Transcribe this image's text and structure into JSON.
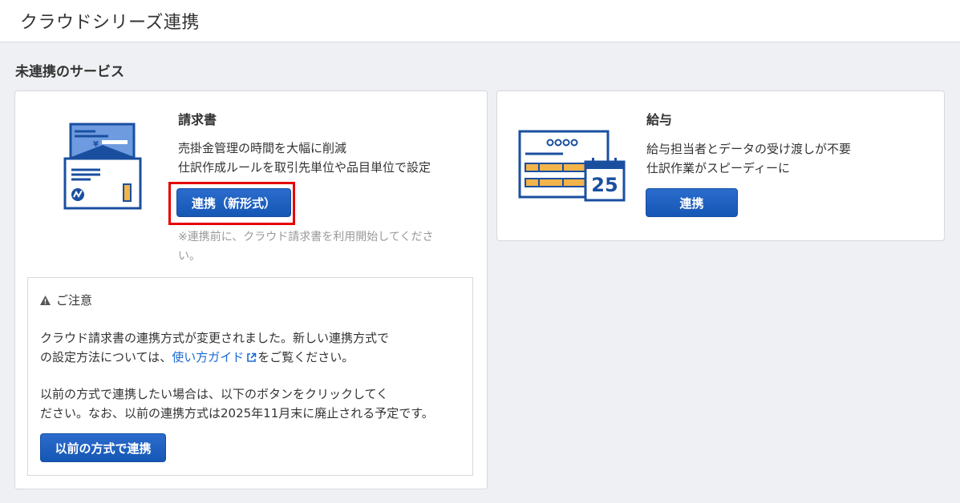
{
  "header": {
    "title": "クラウドシリーズ連携"
  },
  "section": {
    "title": "未連携のサービス"
  },
  "invoice": {
    "name": "請求書",
    "desc_line1": "売掛金管理の時間を大幅に削減",
    "desc_line2": "仕訳作成ルールを取引先単位や品目単位で設定",
    "button": "連携（新形式）",
    "note_line1": "※連携前に、クラウド請求書を利用開始してくださ",
    "note_line2": "い。",
    "caution": {
      "title": "ご注意",
      "p1_line1": "クラウド請求書の連携方式が変更されました。新しい連携方式で",
      "p1_line2_pre": "の設定方法については、",
      "p1_link": "使い方ガイド",
      "p1_line2_post": "をご覧ください。",
      "p2_line1": "以前の方式で連携したい場合は、以下のボタンをクリックしてく",
      "p2_line2": "ださい。なお、以前の連携方式は2025年11月末に廃止される予定です。",
      "button": "以前の方式で連携"
    }
  },
  "payroll": {
    "name": "給与",
    "desc_line1": "給与担当者とデータの受け渡しが不要",
    "desc_line2": "仕訳作業がスピーディーに",
    "button": "連携",
    "calendar_day": "25"
  },
  "icons": {
    "invoice_illustration": "invoice-envelope-icon",
    "payroll_illustration": "payroll-calendar-icon",
    "warning": "warning-icon",
    "external_link": "external-link-icon",
    "yen_symbol": "¥"
  },
  "colors": {
    "primary": "#1a5bb8",
    "accent_orange": "#f2b44b",
    "highlight_red": "#e60000",
    "link": "#1a6ad2"
  }
}
